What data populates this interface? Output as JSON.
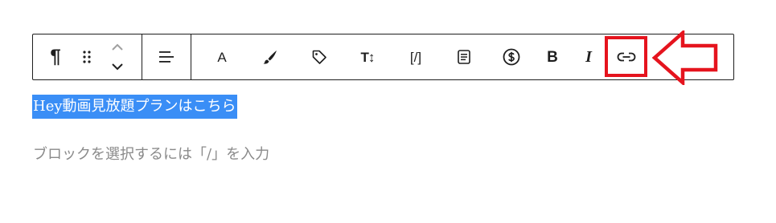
{
  "toolbar": {
    "paragraph_glyph": "¶",
    "highlight_glyph": "A",
    "font_size_glyph": "T↕",
    "shortcode_glyph": "[/]",
    "bold_glyph": "B",
    "italic_glyph": "I"
  },
  "icons": {
    "block_type": "paragraph-icon",
    "drag": "drag-handle-icon",
    "move": "move-up-down-icon",
    "align": "align-icon",
    "highlight": "text-color-icon",
    "brush": "brush-icon",
    "tag": "tag-icon",
    "font_size": "font-size-icon",
    "shortcode": "shortcode-icon",
    "document": "document-icon",
    "dollar": "dollar-icon",
    "bold": "bold-icon",
    "italic": "italic-icon",
    "link": "link-icon"
  },
  "content": {
    "selected_text": "Hey動画見放題プランはこちら",
    "placeholder": "ブロックを選択するには「/」を入力"
  },
  "colors": {
    "annotation": "#e5141e",
    "selection": "#3a8ef6",
    "text": "#1e1e1e",
    "placeholder": "#8a8a8a"
  }
}
